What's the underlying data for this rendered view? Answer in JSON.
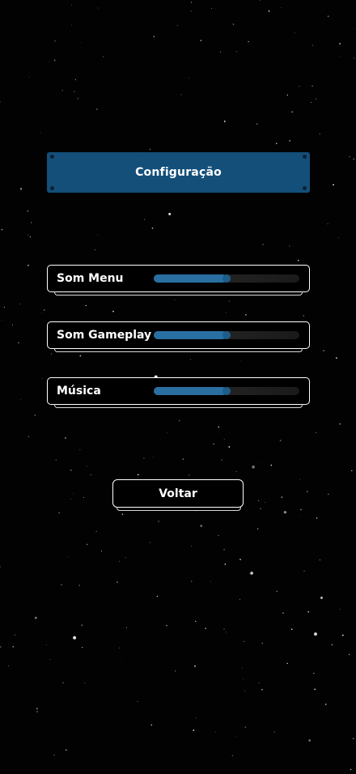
{
  "header": {
    "title": "Configuração"
  },
  "settings": [
    {
      "label": "Som Menu",
      "volume": 0.5
    },
    {
      "label": "Som Gameplay",
      "volume": 0.5
    },
    {
      "label": "Música",
      "volume": 0.5
    }
  ],
  "back_button": {
    "label": "Voltar"
  },
  "colors": {
    "background": "#020202",
    "banner": "#134f79",
    "slider_fill": "#2a6fa1",
    "slider_handle": "#1e5d8b",
    "border": "#ffffff",
    "text": "#ffffff"
  }
}
